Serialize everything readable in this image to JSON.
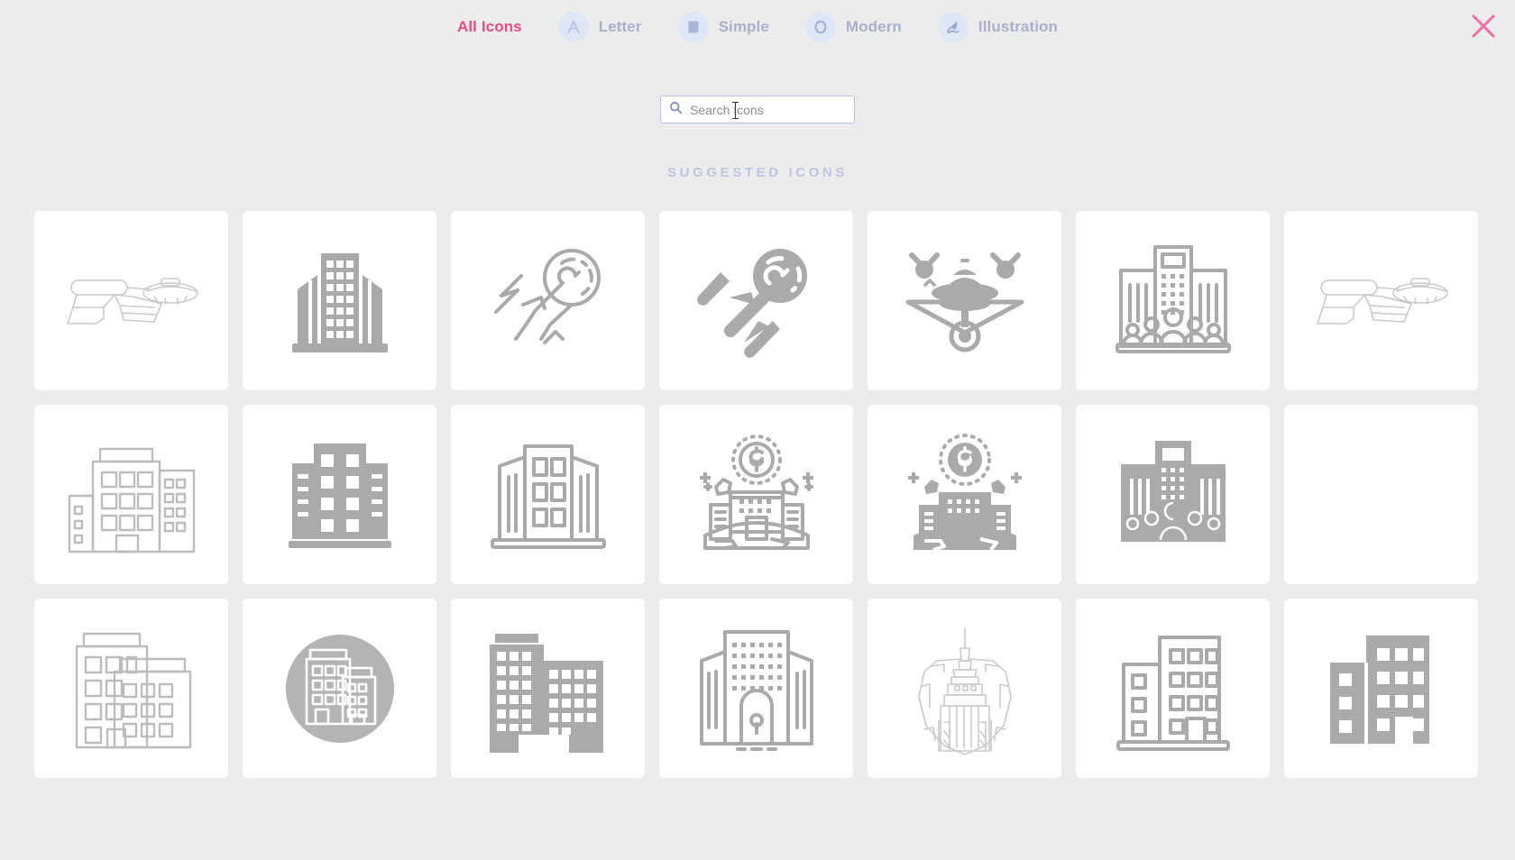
{
  "tabs": [
    {
      "label": "All Icons",
      "icon": "none",
      "active": true
    },
    {
      "label": "Letter",
      "icon": "letter-a-icon",
      "active": false
    },
    {
      "label": "Simple",
      "icon": "square-icon",
      "active": false
    },
    {
      "label": "Modern",
      "icon": "circle-ring-icon",
      "active": false
    },
    {
      "label": "Illustration",
      "icon": "brush-icon",
      "active": false
    }
  ],
  "close": {
    "name": "close-icon",
    "color": "#ed6fa4"
  },
  "search": {
    "placeholder": "Search Icons",
    "value": "",
    "icon": "search-icon"
  },
  "section": {
    "title": "SUGGESTED ICONS"
  },
  "colors": {
    "background": "#ececec",
    "card": "#ffffff",
    "accent_pink": "#ea4c85",
    "tab_text": "#aab0cc",
    "tab_pill": "#dfe6f5",
    "section_title": "#bcc6e0",
    "icon_gray": "#aaaaaa",
    "search_border": "#b9c0de"
  },
  "grid": {
    "columns": 7,
    "rows": 3,
    "items": [
      {
        "name": "starship-outline-icon",
        "style": "outline",
        "row": 1,
        "col": 1
      },
      {
        "name": "office-tower-solid-icon",
        "style": "solid",
        "row": 1,
        "col": 2
      },
      {
        "name": "enterprise-ship-outline-icon",
        "style": "outline",
        "row": 1,
        "col": 3
      },
      {
        "name": "enterprise-ship-solid-icon",
        "style": "solid",
        "row": 1,
        "col": 4
      },
      {
        "name": "ufo-saucer-solid-icon",
        "style": "solid",
        "row": 1,
        "col": 5
      },
      {
        "name": "building-with-people-outline-icon",
        "style": "outline",
        "row": 1,
        "col": 6
      },
      {
        "name": "starship-outline-light-icon",
        "style": "outline",
        "row": 1,
        "col": 7
      },
      {
        "name": "city-buildings-outline-icon",
        "style": "outline",
        "row": 2,
        "col": 1
      },
      {
        "name": "apartment-block-solid-icon",
        "style": "solid",
        "row": 2,
        "col": 2
      },
      {
        "name": "office-buildings-outline-icon",
        "style": "outline",
        "row": 2,
        "col": 3
      },
      {
        "name": "global-bank-dollar-outline-icon",
        "style": "outline",
        "row": 2,
        "col": 4
      },
      {
        "name": "global-bank-dollar-solid-icon",
        "style": "solid",
        "row": 2,
        "col": 5
      },
      {
        "name": "building-with-people-solid-icon",
        "style": "solid",
        "row": 2,
        "col": 6
      },
      {
        "name": "empty-card",
        "style": "empty",
        "row": 2,
        "col": 7
      },
      {
        "name": "twin-buildings-outline-icon",
        "style": "outline",
        "row": 3,
        "col": 1
      },
      {
        "name": "buildings-circle-badge-icon",
        "style": "solid",
        "row": 3,
        "col": 2
      },
      {
        "name": "city-block-solid-icon",
        "style": "solid",
        "row": 3,
        "col": 3
      },
      {
        "name": "civic-building-outline-icon",
        "style": "outline",
        "row": 3,
        "col": 4
      },
      {
        "name": "empire-state-building-icon",
        "style": "outline",
        "row": 3,
        "col": 5
      },
      {
        "name": "two-buildings-outline-icon",
        "style": "outline",
        "row": 3,
        "col": 6
      },
      {
        "name": "two-buildings-solid-icon",
        "style": "solid",
        "row": 3,
        "col": 7
      }
    ]
  }
}
